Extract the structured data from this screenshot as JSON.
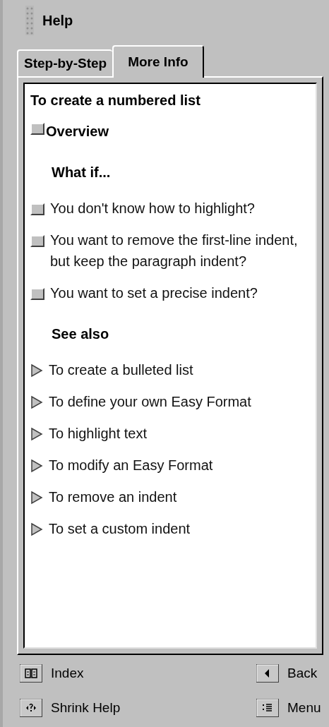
{
  "window": {
    "title": "Help"
  },
  "tabs": [
    {
      "label": "Step-by-Step",
      "selected": false
    },
    {
      "label": "More Info",
      "selected": true
    }
  ],
  "topic": {
    "title": "To create a numbered list",
    "overview": "Overview",
    "sections": [
      {
        "heading": "What if...",
        "items": [
          {
            "kind": "popup",
            "text": "You don't know how to highlight?"
          },
          {
            "kind": "popup",
            "text": "You want to remove the first-line indent, but keep the paragraph indent?"
          },
          {
            "kind": "popup",
            "text": "You want to set a precise indent?"
          }
        ]
      },
      {
        "heading": "See also",
        "items": [
          {
            "kind": "jump",
            "text": "To create a bulleted list"
          },
          {
            "kind": "jump",
            "text": "To define your own Easy Format"
          },
          {
            "kind": "jump",
            "text": "To highlight text"
          },
          {
            "kind": "jump",
            "text": "To modify an Easy Format"
          },
          {
            "kind": "jump",
            "text": "To remove an indent"
          },
          {
            "kind": "jump",
            "text": "To set a custom indent"
          }
        ]
      }
    ]
  },
  "footer": [
    {
      "kind": "index",
      "label": "Index"
    },
    {
      "kind": "back",
      "label": "Back"
    },
    {
      "kind": "shrink",
      "label": "Shrink Help"
    },
    {
      "kind": "menu",
      "label": "Menu"
    }
  ]
}
